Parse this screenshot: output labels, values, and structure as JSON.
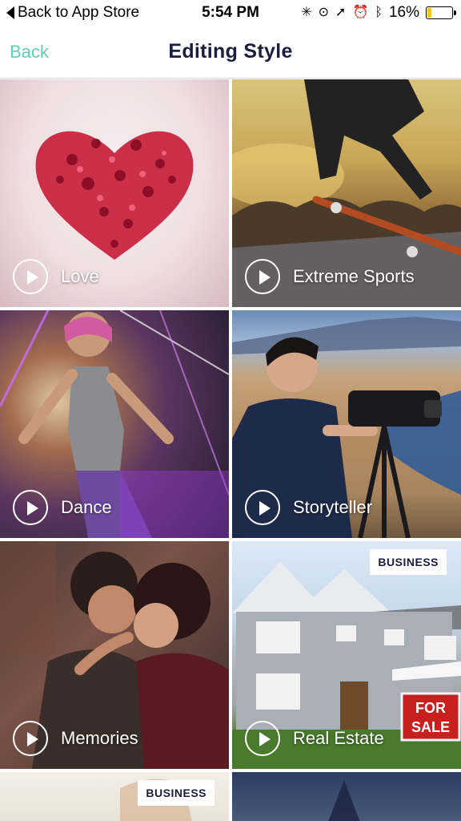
{
  "status_bar": {
    "back_label": "Back to App Store",
    "time": "5:54 PM",
    "battery_text": "16%",
    "battery_level": 0.16,
    "icons": [
      "activity-spinner-icon",
      "orientation-lock-icon",
      "location-arrow-icon",
      "alarm-icon",
      "bluetooth-icon",
      "battery-icon"
    ]
  },
  "nav": {
    "back_label": "Back",
    "title": "Editing Style"
  },
  "colors": {
    "accent": "#5fd0b4",
    "title": "#1a1d3b",
    "battery": "#f5c518"
  },
  "tiles": [
    {
      "name": "Love",
      "badge": ""
    },
    {
      "name": "Extreme Sports",
      "badge": ""
    },
    {
      "name": "Dance",
      "badge": ""
    },
    {
      "name": "Storyteller",
      "badge": ""
    },
    {
      "name": "Memories",
      "badge": ""
    },
    {
      "name": "Real Estate",
      "badge": "BUSINESS"
    },
    {
      "name": "",
      "badge": "BUSINESS"
    },
    {
      "name": "",
      "badge": ""
    }
  ]
}
